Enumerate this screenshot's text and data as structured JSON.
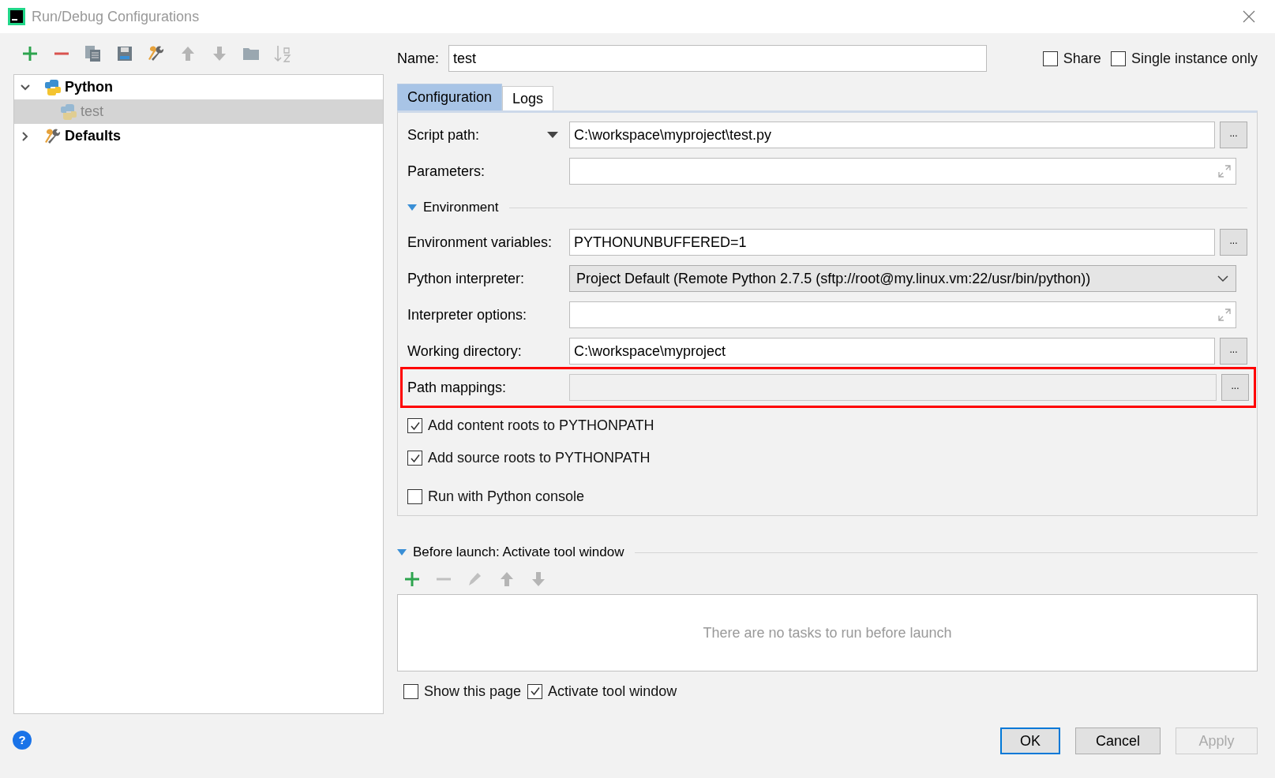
{
  "window": {
    "title": "Run/Debug Configurations"
  },
  "tree": [
    {
      "label": "Python",
      "kind": "python",
      "bold": true,
      "expanded": true,
      "selected": false,
      "children": [
        {
          "label": "test",
          "kind": "python",
          "bold": false,
          "selected": true,
          "disabled": true
        }
      ]
    },
    {
      "label": "Defaults",
      "kind": "wrench",
      "bold": true,
      "expanded": false,
      "selected": false
    }
  ],
  "name_field": {
    "label": "Name:",
    "value": "test"
  },
  "options": [
    {
      "label": "Share",
      "checked": false
    },
    {
      "label": "Single instance only",
      "checked": false
    }
  ],
  "tabs": [
    {
      "label": "Configuration",
      "selected": true
    },
    {
      "label": "Logs",
      "selected": false
    }
  ],
  "fields_top": [
    {
      "label": "Script path:",
      "kind": "browse",
      "button": "...",
      "value": "C:\\workspace\\myproject\\test.py",
      "label_dropdown": true,
      "highlighted": false
    },
    {
      "label": "Parameters:",
      "kind": "expand",
      "label_dropdown": false,
      "highlighted": false
    }
  ],
  "environment": {
    "title": "Environment",
    "expanded": true
  },
  "fields_env": [
    {
      "label": "Environment variables:",
      "kind": "browse",
      "button": "...",
      "value": "PYTHONUNBUFFERED=1",
      "label_dropdown": false,
      "highlighted": false
    },
    {
      "label": "Python interpreter:",
      "kind": "select",
      "value": "Project Default (Remote Python 2.7.5 (sftp://root@my.linux.vm:22/usr/bin/python))",
      "label_dropdown": false,
      "highlighted": false
    },
    {
      "label": "Interpreter options:",
      "kind": "expand",
      "label_dropdown": false,
      "highlighted": false
    },
    {
      "label": "Working directory:",
      "kind": "browse",
      "button": "...",
      "value": "C:\\workspace\\myproject",
      "label_dropdown": false,
      "highlighted": false
    },
    {
      "label": "Path mappings:",
      "kind": "browse",
      "button": "...",
      "label_dropdown": false,
      "highlighted": true
    }
  ],
  "checkboxes": [
    {
      "label": "Add content roots to PYTHONPATH",
      "checked": true
    },
    {
      "label": "Add source roots to PYTHONPATH",
      "checked": true
    },
    {
      "label": "Run with Python console",
      "checked": false
    }
  ],
  "before_launch": {
    "title": "Before launch: Activate tool window",
    "expanded": true,
    "empty_text": "There are no tasks to run before launch",
    "options": [
      {
        "label": "Show this page",
        "checked": false
      },
      {
        "label": "Activate tool window",
        "checked": true
      }
    ]
  },
  "help": "?",
  "buttons": [
    {
      "label": "OK",
      "default": true,
      "disabled": false
    },
    {
      "label": "Cancel",
      "default": false,
      "disabled": false
    },
    {
      "label": "Apply",
      "default": false,
      "disabled": true
    }
  ]
}
